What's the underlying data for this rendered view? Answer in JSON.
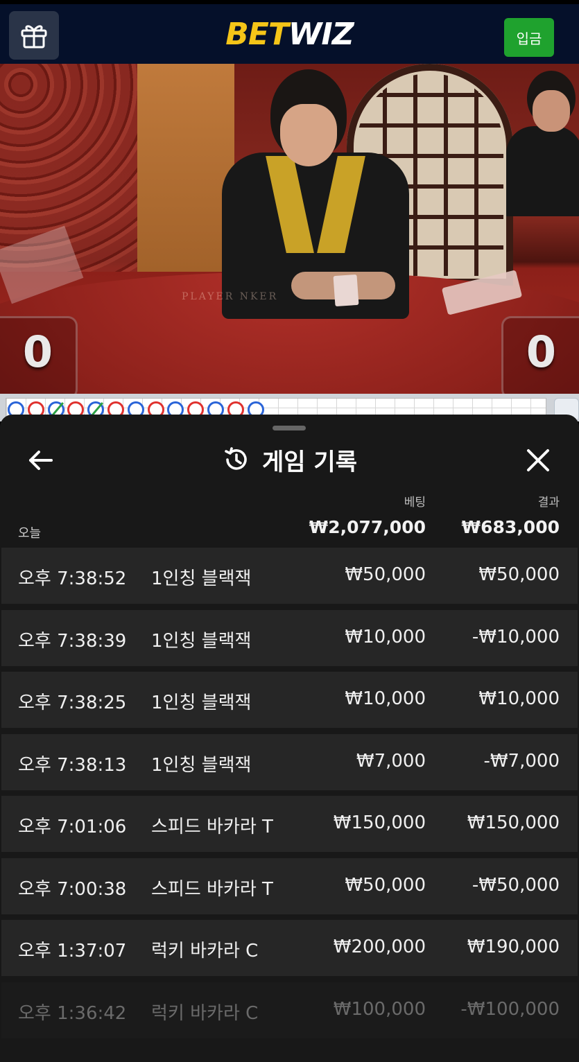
{
  "header": {
    "logo_bet": "BET",
    "logo_wiz": "WIZ",
    "deposit_label": "입금",
    "gift_icon": "gift-icon"
  },
  "video": {
    "player_score": "0",
    "banker_score": "0",
    "felt_text": "PLAYER         NKER"
  },
  "road": {
    "beads": [
      "p",
      "b",
      "p-tie",
      "b",
      "p-tie",
      "b",
      "p",
      "b",
      "p",
      "b",
      "p",
      "b",
      "p"
    ]
  },
  "panel": {
    "title": "게임 기록",
    "back_icon": "arrow-left-icon",
    "history_icon": "history-icon",
    "close_icon": "close-icon",
    "bet_header": "베팅",
    "result_header": "결과",
    "today_label": "오늘",
    "total_bet": "₩2,077,000",
    "total_result": "₩683,000",
    "rows": [
      {
        "time": "오후 7:38:52",
        "game": "1인칭 블랙잭",
        "bet": "₩50,000",
        "result": "₩50,000"
      },
      {
        "time": "오후 7:38:39",
        "game": "1인칭 블랙잭",
        "bet": "₩10,000",
        "result": "-₩10,000"
      },
      {
        "time": "오후 7:38:25",
        "game": "1인칭 블랙잭",
        "bet": "₩10,000",
        "result": "₩10,000"
      },
      {
        "time": "오후 7:38:13",
        "game": "1인칭 블랙잭",
        "bet": "₩7,000",
        "result": "-₩7,000"
      },
      {
        "time": "오후 7:01:06",
        "game": "스피드 바카라 T",
        "bet": "₩150,000",
        "result": "₩150,000"
      },
      {
        "time": "오후 7:00:38",
        "game": "스피드 바카라 T",
        "bet": "₩50,000",
        "result": "-₩50,000"
      },
      {
        "time": "오후 1:37:07",
        "game": "럭키 바카라 C",
        "bet": "₩200,000",
        "result": "₩190,000"
      },
      {
        "time": "오후 1:36:42",
        "game": "럭키 바카라 C",
        "bet": "₩100,000",
        "result": "-₩100,000"
      }
    ]
  },
  "colors": {
    "header_bg": "#05102a",
    "logo_yellow": "#f5c518",
    "deposit_green": "#1fa22e",
    "panel_bg": "#181818",
    "row_bg": "#262626",
    "bead_player": "#2a64d8",
    "bead_banker": "#e0312e",
    "bead_tie": "#2aa043"
  }
}
